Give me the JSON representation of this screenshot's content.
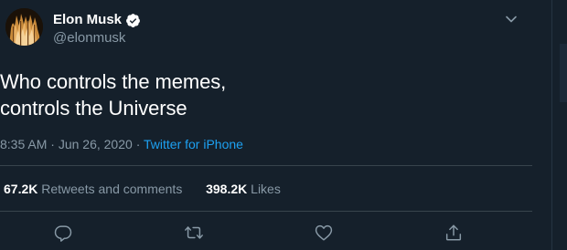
{
  "author": {
    "display_name": "Elon Musk",
    "handle": "@elonmusk",
    "verified": true
  },
  "tweet": {
    "text": "Who controls the memes,\ncontrols the Universe",
    "time": "8:35 AM",
    "date": "Jun 26, 2020",
    "source": "Twitter for iPhone"
  },
  "stats": {
    "retweets_count": "67.2K",
    "retweets_label": "Retweets and comments",
    "likes_count": "398.2K",
    "likes_label": "Likes"
  },
  "icons": {
    "verified": "verified-badge-icon",
    "more": "chevron-down-icon",
    "reply": "reply-icon",
    "retweet": "retweet-icon",
    "like": "heart-icon",
    "share": "share-icon"
  },
  "colors": {
    "background": "#15202b",
    "text_primary": "#ffffff",
    "text_secondary": "#8899a6",
    "link": "#1da1f2",
    "divider": "#38444d"
  }
}
